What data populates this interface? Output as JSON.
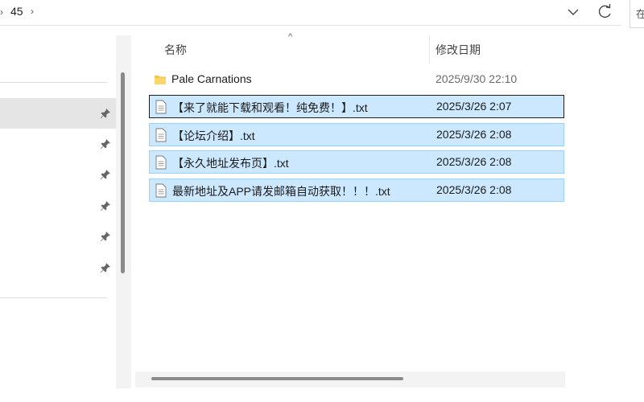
{
  "address_bar": {
    "breadcrumb": "45",
    "refresh_icon": "refresh-icon",
    "dropdown_icon": "chevron-down-icon"
  },
  "search": {
    "placeholder_fragment": "在"
  },
  "columns": {
    "name": "名称",
    "date": "修改日期"
  },
  "files": [
    {
      "name": "Pale Carnations",
      "date": "2025/9/30 22:10",
      "type": "folder",
      "selected": false
    },
    {
      "name": "【来了就能下载和观看！纯免费！】.txt",
      "date": "2025/3/26 2:07",
      "type": "txt",
      "selected": true,
      "focused": true
    },
    {
      "name": "【论坛介绍】.txt",
      "date": "2025/3/26 2:08",
      "type": "txt",
      "selected": true
    },
    {
      "name": "【永久地址发布页】.txt",
      "date": "2025/3/26 2:08",
      "type": "txt",
      "selected": true
    },
    {
      "name": "最新地址及APP请发邮箱自动获取！！！.txt",
      "date": "2025/3/26 2:08",
      "type": "txt",
      "selected": true
    }
  ],
  "colors": {
    "selection_bg": "#cce8ff",
    "selection_border": "#99d1ff",
    "folder": "#f6c350"
  }
}
